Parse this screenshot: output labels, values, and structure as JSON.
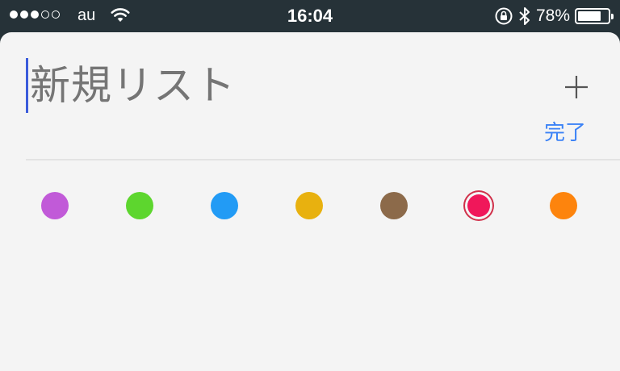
{
  "status_bar": {
    "signal_full": 3,
    "signal_total": 5,
    "carrier": "au",
    "time": "16:04",
    "battery": "78%",
    "battery_level": 0.78,
    "icons": [
      "wifi-icon",
      "rotation-lock-icon",
      "bluetooth-icon",
      "battery-icon"
    ]
  },
  "new_list": {
    "title_placeholder": "新規リスト",
    "title_value": "",
    "add_icon": "plus-icon",
    "done_label": "完了"
  },
  "colors": [
    {
      "name": "purple",
      "hex": "#c15ad8",
      "selected": false
    },
    {
      "name": "green",
      "hex": "#5dd62e",
      "selected": false
    },
    {
      "name": "blue",
      "hex": "#229bf5",
      "selected": false
    },
    {
      "name": "yellow",
      "hex": "#e8b10f",
      "selected": false
    },
    {
      "name": "brown",
      "hex": "#8c6a4a",
      "selected": false
    },
    {
      "name": "red",
      "hex": "#f0175a",
      "selected": true
    },
    {
      "name": "orange",
      "hex": "#fd840d",
      "selected": false
    }
  ]
}
